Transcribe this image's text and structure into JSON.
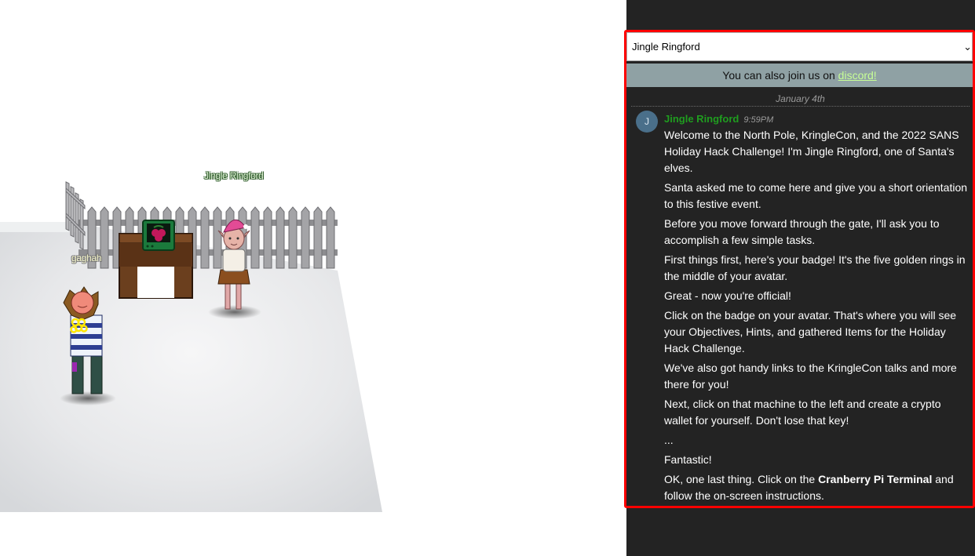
{
  "game": {
    "npc_name": "Jingle Ringford",
    "player_name": "gaghah"
  },
  "chat": {
    "channel": "Jingle Ringford",
    "discord": {
      "prefix": "You can also join us on ",
      "link": "discord!"
    },
    "date": "January 4th",
    "avatar_letter": "J",
    "message": {
      "sender": "Jingle Ringford",
      "time": "9:59PM",
      "paragraphs": [
        "Welcome to the North Pole, KringleCon, and the 2022 SANS Holiday Hack Challenge! I'm Jingle Ringford, one of Santa's elves.",
        "Santa asked me to come here and give you a short orientation to this festive event.",
        "Before you move forward through the gate, I'll ask you to accomplish a few simple tasks.",
        "First things first, here's your badge! It's the five golden rings in the middle of your avatar.",
        "Great - now you're official!",
        "Click on the badge on your avatar. That's where you will see your Objectives, Hints, and gathered Items for the Holiday Hack Challenge.",
        "We've also got handy links to the KringleCon talks and more there for you!",
        "Next, click on that machine to the left and create a crypto wallet for yourself. Don't lose that key!",
        "...",
        "Fantastic!"
      ],
      "last_paragraph": {
        "before": "OK, one last thing. Click on the ",
        "bold": "Cranberry Pi Terminal",
        "after": " and follow the on-screen instructions."
      }
    }
  },
  "colors": {
    "highlight_border": "#ff0000",
    "panel_bg": "#232323",
    "sender": "#1f9d1f",
    "discord_link": "#c7ff96"
  }
}
